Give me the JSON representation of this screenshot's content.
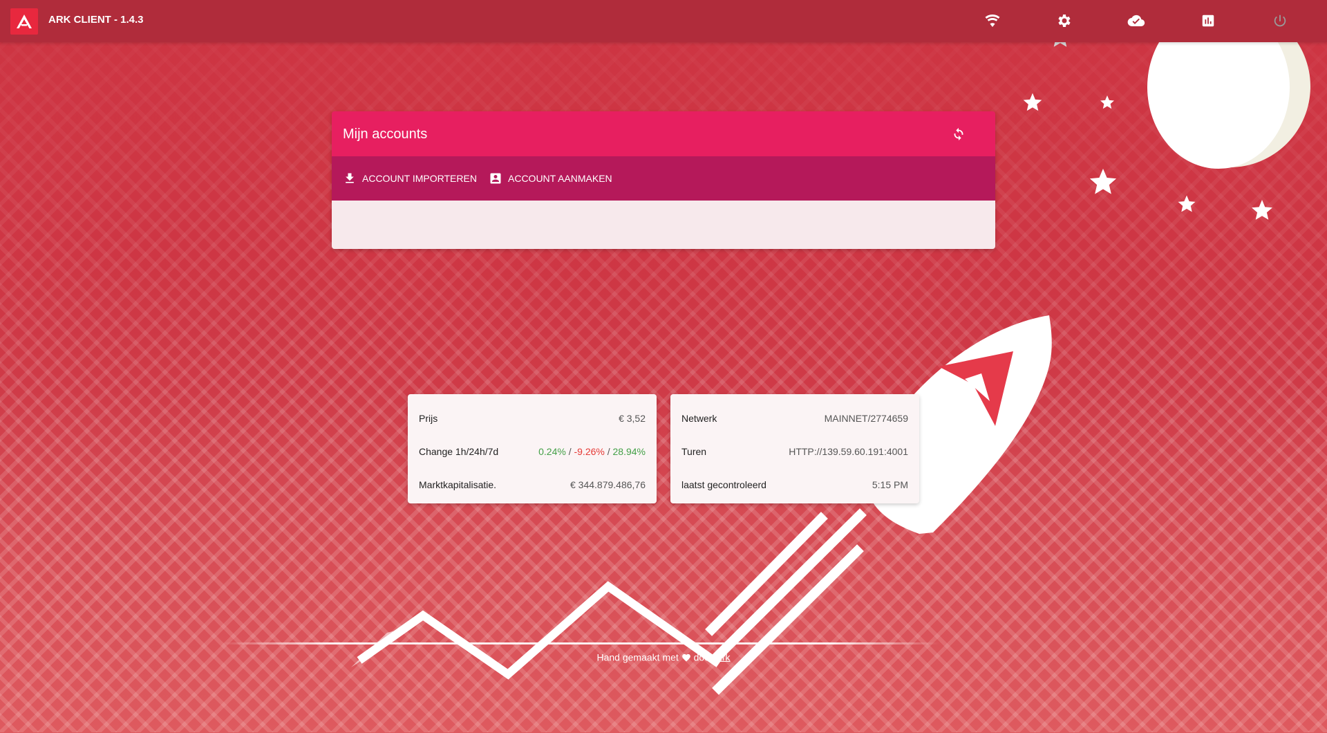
{
  "app": {
    "title": "ARK CLIENT - 1.4.3"
  },
  "topbar": {
    "icons": [
      "wifi-icon",
      "settings-icon",
      "cloud-icon",
      "chart-icon",
      "power-icon"
    ]
  },
  "accounts": {
    "title": "Mijn accounts",
    "import_label": "ACCOUNT IMPORTEREN",
    "create_label": "ACCOUNT AANMAKEN"
  },
  "market": {
    "price_label": "Prijs",
    "price_value": "€ 3,52",
    "change_label": "Change 1h/24h/7d",
    "change_1h": "0.24%",
    "change_24h": "-9.26%",
    "change_7d": "28.94%",
    "separator": "/",
    "cap_label": "Marktkapitalisatie.",
    "cap_value": "€ 344.879.486,76"
  },
  "network": {
    "network_label": "Netwerk",
    "network_value": "MAINNET/2774659",
    "peer_label": "Turen",
    "peer_value": "HTTP://139.59.60.191:4001",
    "checked_label": "laatst gecontroleerd",
    "checked_value": "5:15 PM"
  },
  "footer": {
    "text_before": "Hand gemaakt met",
    "text_by": "door",
    "link": "Ark"
  },
  "colors": {
    "topbar": "#b02c3b",
    "card_header": "#e71f60",
    "card_toolbar": "#b5195a",
    "positive": "#43a047",
    "negative": "#e53935"
  }
}
